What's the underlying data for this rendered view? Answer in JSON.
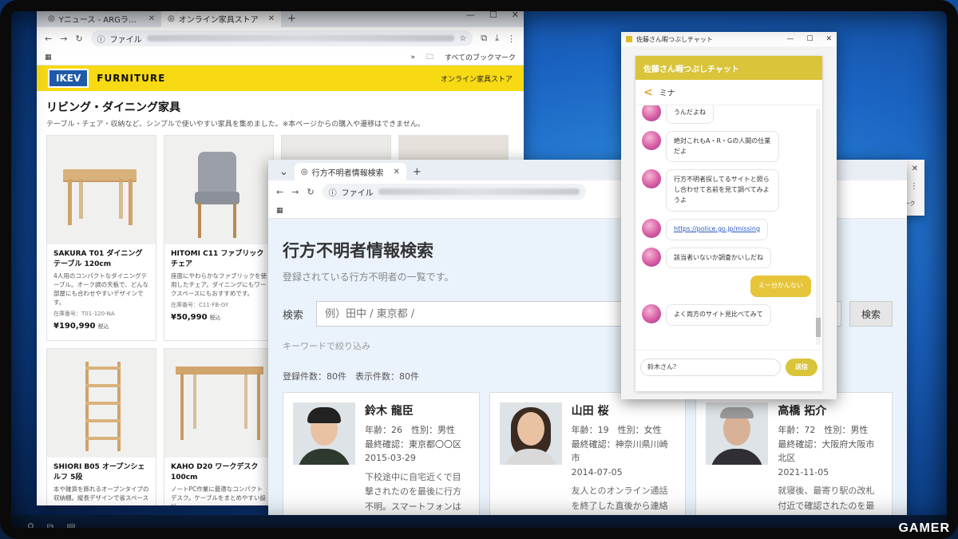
{
  "browser1": {
    "tabs": [
      {
        "label": "Yニュース - ARGラボと関連ニュース",
        "active": false
      },
      {
        "label": "オンライン家具ストア",
        "active": true
      }
    ],
    "omnibox_label": "ファイル",
    "bookmarks_label": "すべてのブックマーク"
  },
  "ikev": {
    "logo": "IKEV",
    "brand": "FURNITURE",
    "header_right": "オンライン家具ストア",
    "title": "リビング・ダイニング家具",
    "description": "テーブル・チェア・収納など、シンプルで使いやすい家具を集めました。※本ページからの購入や遷移はできません。",
    "products": [
      {
        "name": "SAKURA T01 ダイニングテーブル 120cm",
        "desc": "4人用のコンパクトなダイニングテーブル。オーク調の天板で、どんな部屋にも合わせやすいデザインです。",
        "code": "在庫番号：T01-120-NA",
        "price": "¥190,990",
        "tax": "税込"
      },
      {
        "name": "HITOMI C11 ファブリックチェア",
        "desc": "座面にやわらかなファブリックを使用したチェア。ダイニングにもワークスペースにもおすすめです。",
        "code": "在庫番号：C11-FB-GY",
        "price": "¥50,990",
        "tax": "税込"
      },
      {
        "name": "",
        "desc": "",
        "code": "",
        "price": "",
        "tax": ""
      },
      {
        "name": "",
        "desc": "",
        "code": "",
        "price": "",
        "tax": ""
      },
      {
        "name": "SHIORI B05 オープンシェルフ 5段",
        "desc": "本や雑貨を飾れるオープンタイプの収納棚。縦長デザインで省スペース",
        "code": "",
        "price": "",
        "tax": ""
      },
      {
        "name": "KAHO D20 ワークデスク 100cm",
        "desc": "ノートPC作業に最適なコンパクトデスク。ケーブルをまとめやすい設計",
        "code": "",
        "price": "",
        "tax": ""
      }
    ]
  },
  "browser2": {
    "tab_label": "行方不明者情報検索",
    "omnibox_label": "ファイル"
  },
  "missing": {
    "title": "行方不明者情報検索",
    "subtitle": "登録されている行方不明者の一覧です。",
    "search_label": "検索",
    "search_placeholder": "例）田中 / 東京都 /",
    "search_button": "検索",
    "filter_label": "キーワードで絞り込み",
    "count_text": "登録件数：80件　表示件数：80件",
    "people": [
      {
        "name": "鈴木 龍臣",
        "age_sex": "年齢：26　性別：男性",
        "last_seen": "最終確認：東京都〇〇区",
        "date": "2015-03-29",
        "desc": "下校途中に自宅近くで目撃されたのを最後に行方不明。スマートフォンは電源が切られたまま見つかって"
      },
      {
        "name": "山田 桜",
        "age_sex": "年齢：19　性別：女性",
        "last_seen": "最終確認：神奈川県川崎市",
        "date": "2014-07-05",
        "desc": "友人とのオンライン通話を終了した直後から連絡が取れなくなった。自宅には荷"
      },
      {
        "name": "高橋 拓介",
        "age_sex": "年齢：72　性別：男性",
        "last_seen": "最終確認：大阪府大阪市北区",
        "date": "2021-11-05",
        "desc": "就寝後、最寄り駅の改札付近で確認されたのを最後に消息不明。認知症の疑い"
      }
    ]
  },
  "chat": {
    "window_title": "佐藤さん暇つぶしチャット",
    "header": "佐藤さん暇つぶしチャット",
    "contact": "ミナ",
    "messages": [
      {
        "from": "them",
        "text": "うんだよね"
      },
      {
        "from": "them",
        "text": "絶対これもA・R・Gの人間の仕業だよ"
      },
      {
        "from": "them",
        "text": "行方不明者探してるサイトと照らし合わせて名前を見て調べてみようよ"
      },
      {
        "from": "them",
        "text": "https://police.go.jp/missing",
        "link": true
      },
      {
        "from": "them",
        "text": "該当者いないか調査かいしだね"
      },
      {
        "from": "me",
        "text": "えー分かんない"
      },
      {
        "from": "them",
        "text": "よく両方のサイト見比べてみて"
      }
    ],
    "input_value": "鈴木さん？",
    "send_label": "送信"
  },
  "browser4": {
    "bookmarks_label": "すべてのブックマーク"
  },
  "watermark": "GAMER"
}
